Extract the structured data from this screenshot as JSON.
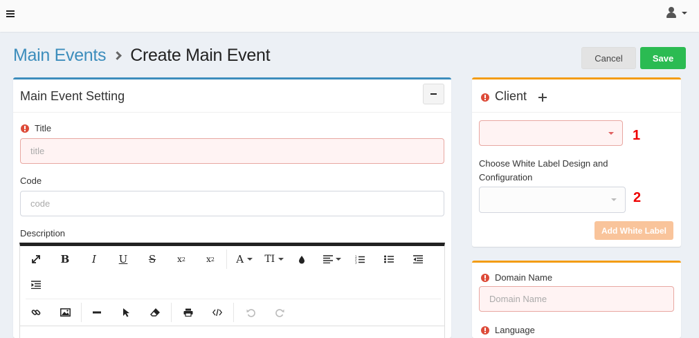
{
  "header": {
    "menu_icon": "hamburger-icon",
    "user_icon": "user-icon"
  },
  "breadcrumb": {
    "parent": "Main Events",
    "current": "Create Main Event"
  },
  "actions": {
    "cancel_label": "Cancel",
    "save_label": "Save",
    "save_color": "#2bbb52"
  },
  "main_settings": {
    "title": "Main Event Setting",
    "title_field": {
      "label": "Title",
      "placeholder": "title"
    },
    "code_field": {
      "label": "Code",
      "placeholder": "code"
    },
    "description_label": "Description",
    "toolbar": {
      "font_color_label": "A",
      "font_size_label": "TI",
      "row1_icons": [
        "fullscreen-icon",
        "bold-icon",
        "italic-icon",
        "underline-icon",
        "strikethrough-icon",
        "subscript-icon",
        "superscript-icon",
        "font-color-icon",
        "font-size-icon",
        "ink-drop-icon",
        "align-icon",
        "ordered-list-icon",
        "unordered-list-icon",
        "outdent-icon",
        "indent-icon"
      ],
      "row2_icons": [
        "link-icon",
        "image-icon",
        "horizontal-rule-icon",
        "pointer-icon",
        "eraser-icon",
        "print-icon",
        "code-view-icon",
        "undo-icon",
        "redo-icon"
      ]
    }
  },
  "client": {
    "title": "Client",
    "select1_number": "1",
    "white_label_text": "Choose White Label Design and Configuration",
    "select2_number": "2",
    "add_white_label": "Add White Label"
  },
  "domain": {
    "domain_label": "Domain Name",
    "domain_placeholder": "Domain Name",
    "language_label": "Language"
  },
  "colors": {
    "primary": "#3c8dbc",
    "warning": "#f39c12",
    "danger": "#dd4b39"
  }
}
